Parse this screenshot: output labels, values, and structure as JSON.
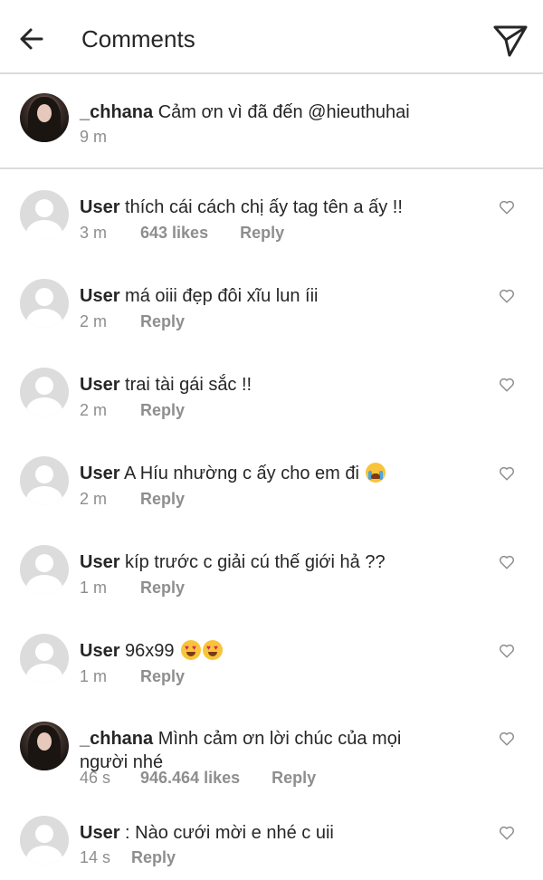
{
  "header": {
    "title": "Comments",
    "back_icon": "arrow-left-icon",
    "send_icon": "paper-plane-icon"
  },
  "caption": {
    "username": "_chhana",
    "text": "Cảm ơn vì đã đến @hieuthuhai",
    "time": "9 m"
  },
  "comments": [
    {
      "username": "User",
      "text": "thích cái cách chị ấy tag tên a ấy !!",
      "time": "3 m",
      "likes": "643 likes",
      "reply": "Reply"
    },
    {
      "username": "User",
      "text": "má oiii đẹp đôi xĩu lun íii",
      "time": "2 m",
      "reply": "Reply"
    },
    {
      "username": "User",
      "text": "trai tài gái sắc !!",
      "time": "2 m",
      "reply": "Reply"
    },
    {
      "username": "User",
      "text": "A Híu nhường c ấy cho em đi",
      "emoji": "loudly-crying-face",
      "time": "2 m",
      "reply": "Reply"
    },
    {
      "username": "User",
      "text": "kíp trước c giải cú thế giới hả ??",
      "time": "1 m",
      "reply": "Reply"
    },
    {
      "username": "User",
      "text": "96x99",
      "emoji": "heart-eyes-face x2",
      "time": "1 m",
      "reply": "Reply"
    },
    {
      "username": "_chhana",
      "text": "Mình cảm ơn lời chúc của mọi người nhé",
      "time": "46 s",
      "likes": "946.464 likes",
      "reply": "Reply"
    },
    {
      "username": "User",
      "text": ": Nào cưới mời e nhé c uii",
      "time": "14 s",
      "reply": "Reply"
    }
  ],
  "colors": {
    "text": "#262626",
    "meta": "#8e8e8e",
    "divider": "#dbdbdb",
    "avatar_placeholder": "#dcdcdc"
  }
}
